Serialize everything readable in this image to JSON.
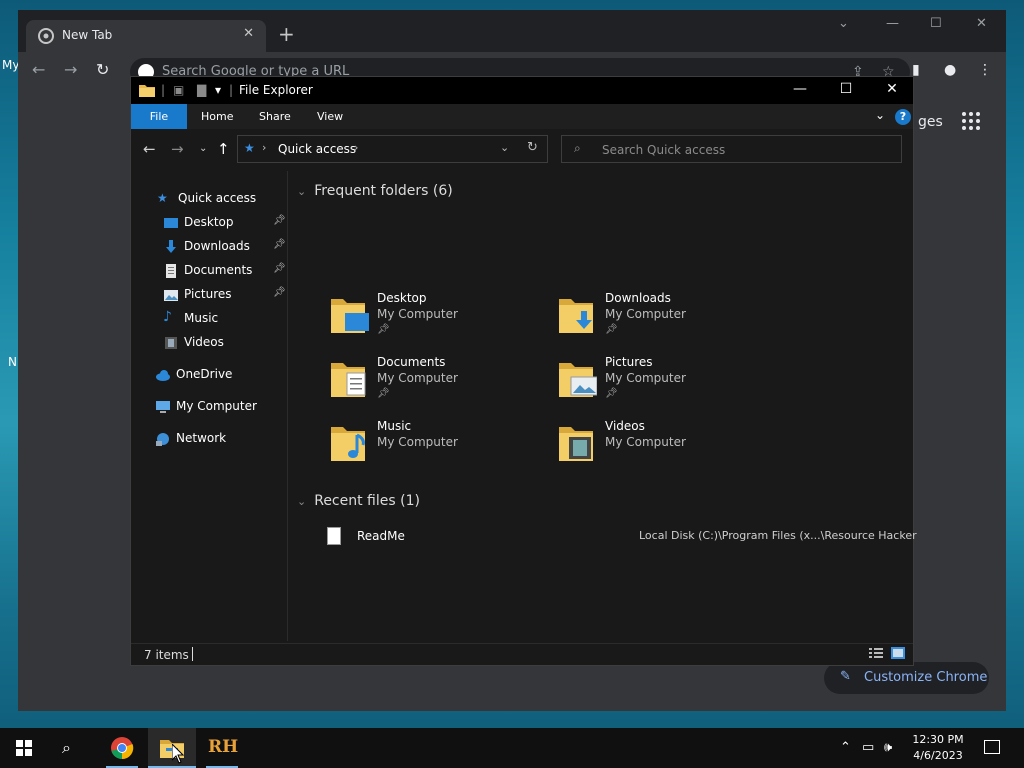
{
  "desktop": {
    "fragments": [
      "My",
      "N"
    ]
  },
  "chrome": {
    "tab_title": "New Tab",
    "tab_close": "✕",
    "new_tab": "+",
    "omnibox_placeholder": "Search Google or type a URL",
    "images_label": "ges",
    "customize_label": "Customize Chrome",
    "accent": "#8ab4f8"
  },
  "explorer": {
    "title": "File Explorer",
    "ribbon_tabs": [
      "File",
      "Home",
      "Share",
      "View"
    ],
    "address_path": "Quick access",
    "search_placeholder": "Search Quick access",
    "nav": {
      "quick_access": "Quick access",
      "pinned": [
        "Desktop",
        "Downloads",
        "Documents",
        "Pictures"
      ],
      "unpinned": [
        "Music",
        "Videos"
      ],
      "onedrive": "OneDrive",
      "my_computer": "My Computer",
      "network": "Network"
    },
    "frequent_header": "Frequent folders (6)",
    "folders": [
      {
        "name": "Desktop",
        "location": "My Computer",
        "pinned": true,
        "icon": "desktop-folder-icon"
      },
      {
        "name": "Downloads",
        "location": "My Computer",
        "pinned": true,
        "icon": "downloads-folder-icon"
      },
      {
        "name": "Documents",
        "location": "My Computer",
        "pinned": true,
        "icon": "documents-folder-icon"
      },
      {
        "name": "Pictures",
        "location": "My Computer",
        "pinned": true,
        "icon": "pictures-folder-icon"
      },
      {
        "name": "Music",
        "location": "My Computer",
        "pinned": false,
        "icon": "music-folder-icon"
      },
      {
        "name": "Videos",
        "location": "My Computer",
        "pinned": false,
        "icon": "videos-folder-icon"
      }
    ],
    "recent_header": "Recent files (1)",
    "recent_files": [
      {
        "name": "ReadMe",
        "path": "Local Disk (C:)\\Program Files (x...\\Resource Hacker"
      }
    ],
    "status_count": "7 items",
    "accent": "#1979ca"
  },
  "taskbar": {
    "time": "12:30 PM",
    "date": "4/6/2023",
    "rh_label": "RH"
  }
}
